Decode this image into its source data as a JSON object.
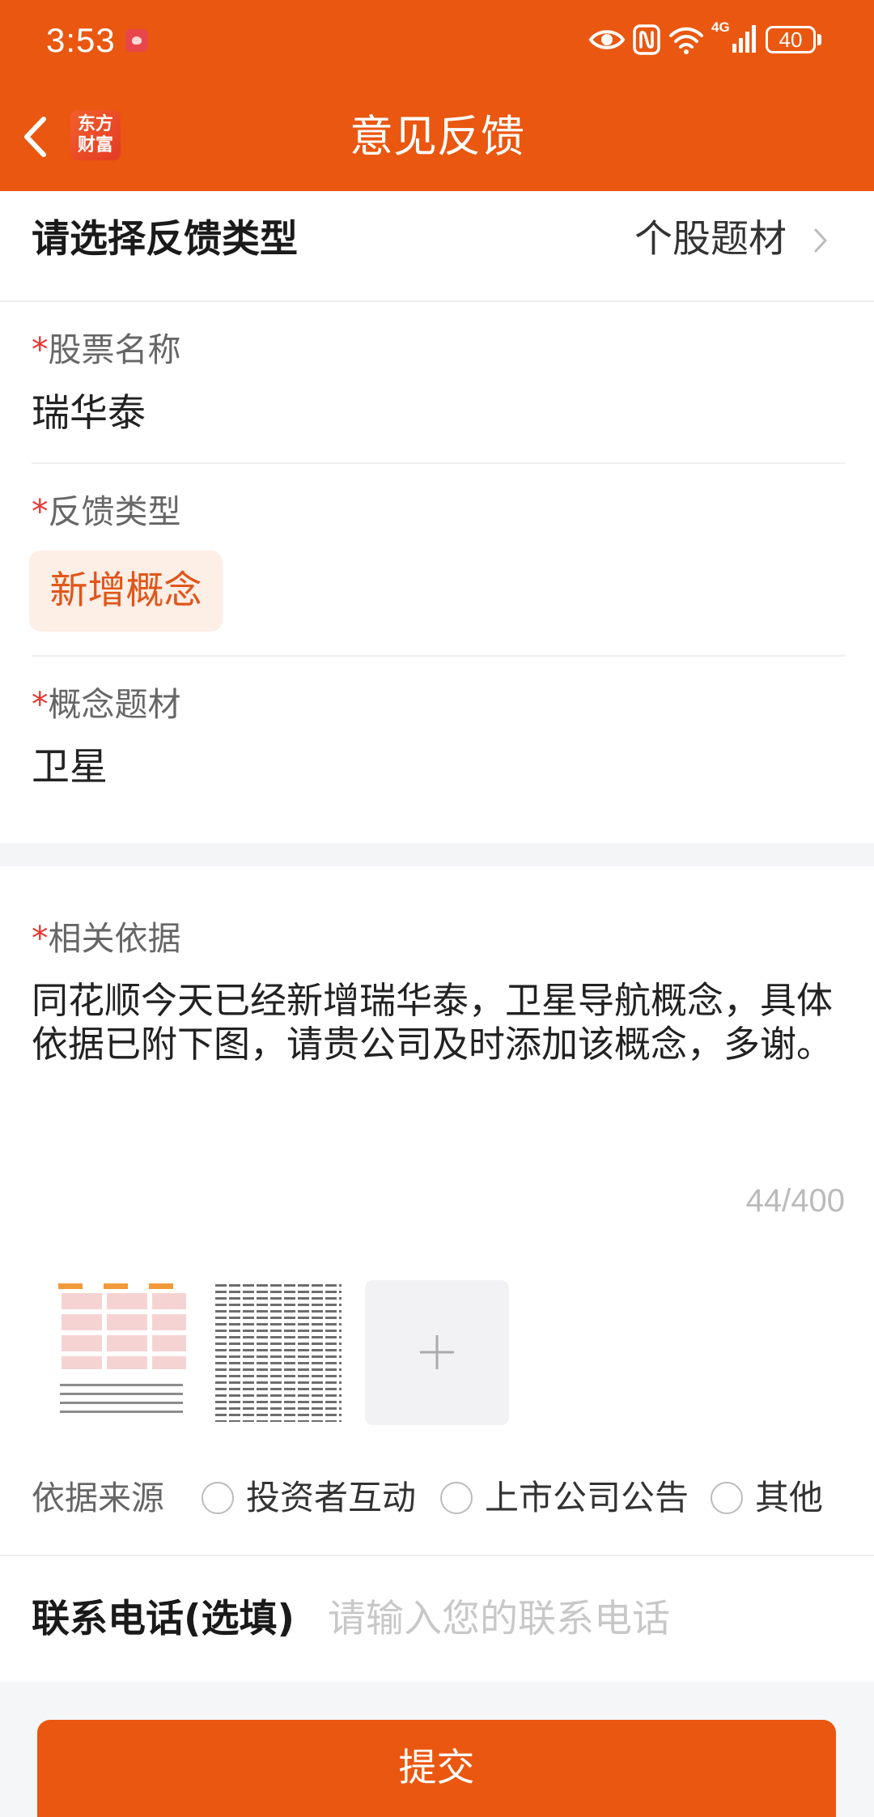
{
  "status_bar": {
    "time": "3:53",
    "network_type": "4G",
    "battery_level": "40",
    "icons": [
      "app-notification-icon",
      "eye-icon",
      "nfc-icon",
      "wifi-icon",
      "cellular-signal-icon",
      "battery-icon"
    ]
  },
  "header": {
    "title": "意见反馈",
    "logo_line_1": "东方",
    "logo_line_2": "财富",
    "back_icon": "chevron-left-icon"
  },
  "feedback_category": {
    "label": "请选择反馈类型",
    "value": "个股题材",
    "icon": "chevron-right-icon"
  },
  "form": {
    "stock_name": {
      "required_mark": "*",
      "label": "股票名称",
      "value": "瑞华泰"
    },
    "feedback_type": {
      "required_mark": "*",
      "label": "反馈类型",
      "selected_tag": "新增概念"
    },
    "concept_topic": {
      "required_mark": "*",
      "label": "概念题材",
      "value": "卫星"
    },
    "evidence": {
      "required_mark": "*",
      "label": "相关依据",
      "text": "同花顺今天已经新增瑞华泰，卫星导航概念，具体依据已附下图，请贵公司及时添加该概念，多谢。",
      "char_count": "44/400",
      "attachment_count": 2,
      "add_image_icon": "plus-icon"
    },
    "evidence_source": {
      "label": "依据来源",
      "options": [
        "投资者互动",
        "上市公司公告",
        "其他"
      ]
    },
    "contact_phone": {
      "label": "联系电话(选填)",
      "placeholder": "请输入您的联系电话"
    }
  },
  "submit_button": {
    "label": "提交"
  },
  "colors": {
    "brand_orange": "#EA5710",
    "tag_background": "#FDEEE6",
    "tag_text": "#E0561A",
    "required_red": "#E53935",
    "section_gray": "#F5F6F8"
  }
}
